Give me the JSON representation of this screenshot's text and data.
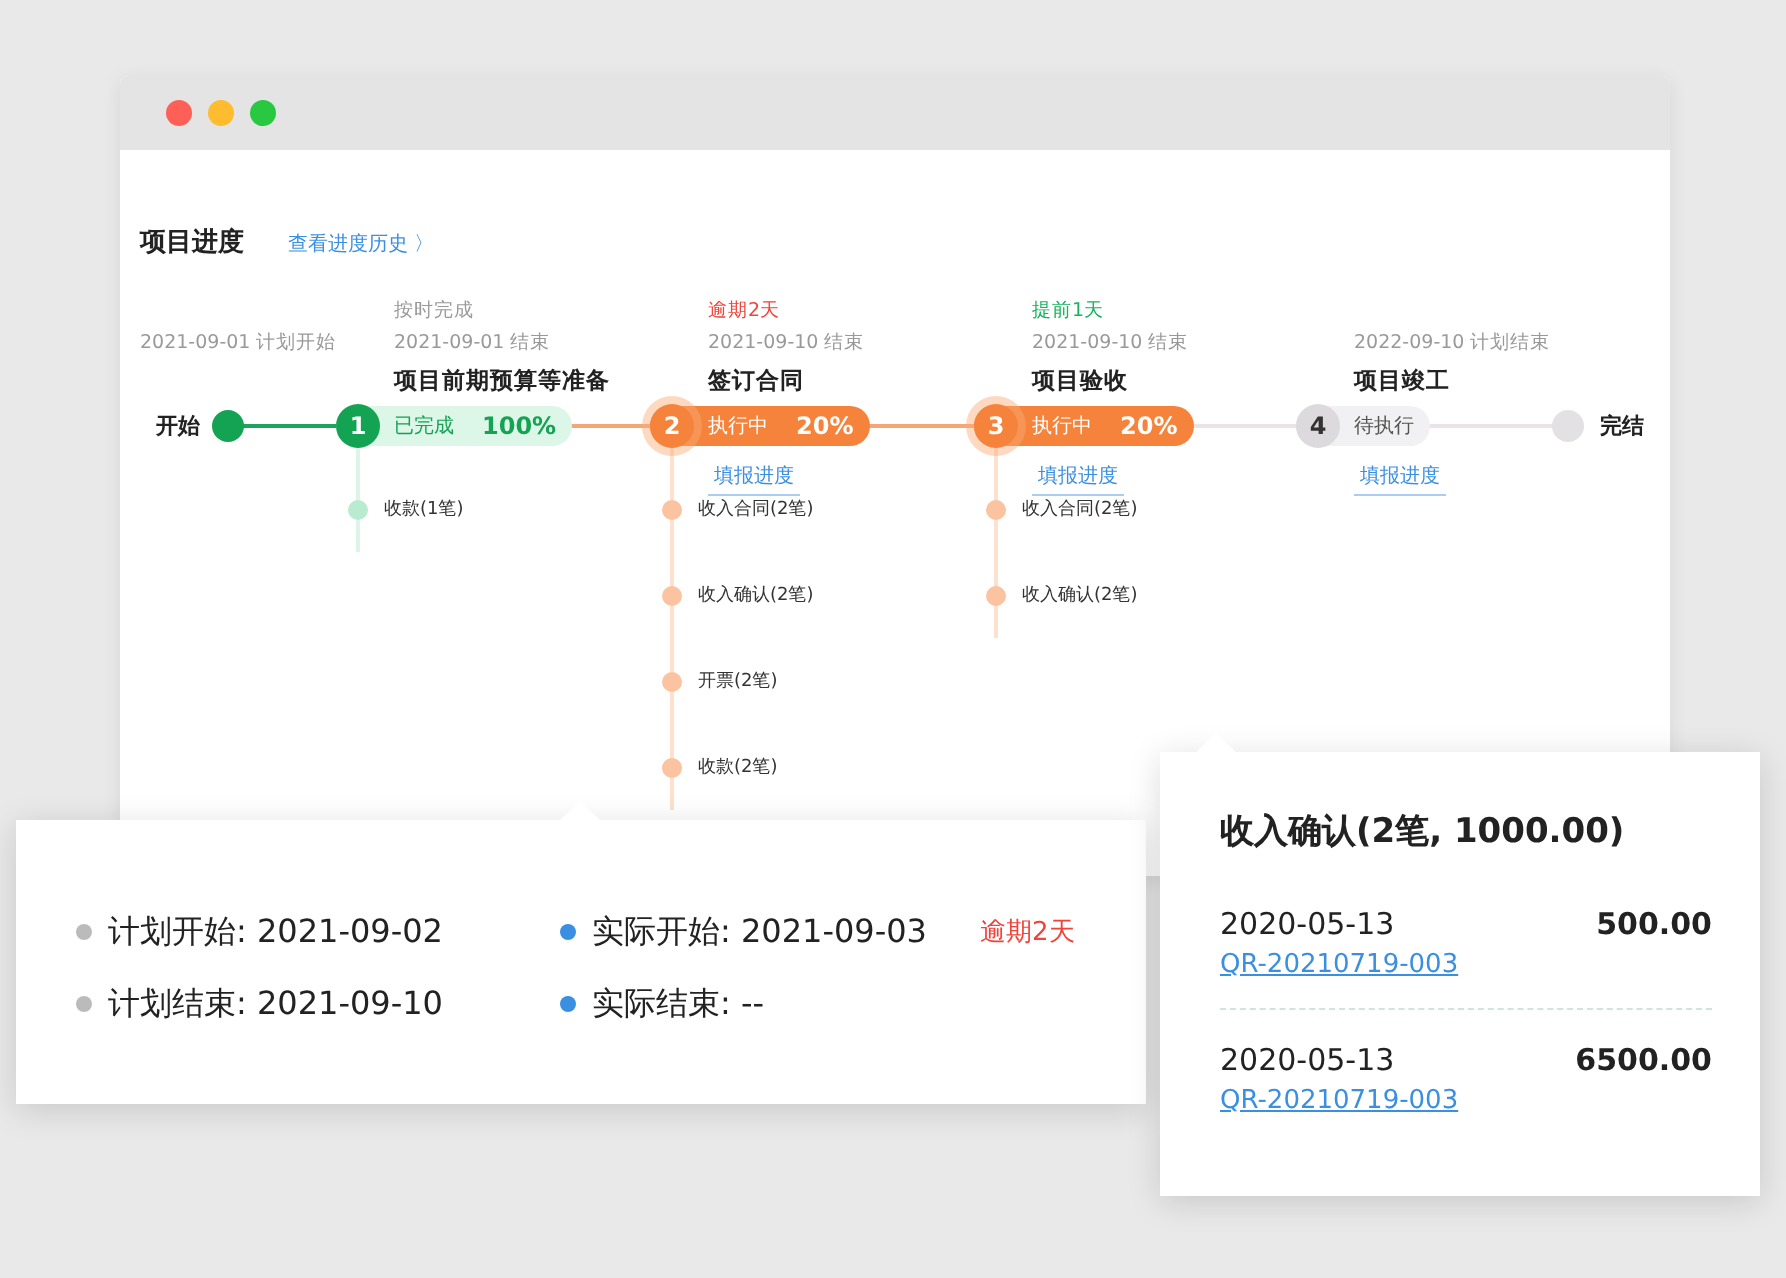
{
  "title": "项目进度",
  "history_link": "查看进度历史 〉",
  "start": {
    "date": "2021-09-01 计划开始",
    "label": "开始"
  },
  "end": {
    "label": "完结"
  },
  "stages": [
    {
      "number": "1",
      "kind": "done",
      "note": {
        "text": "按时完成",
        "color": "#999999"
      },
      "date": "2021-09-01 结束",
      "name": "项目前期预算等准备",
      "status": "已完成",
      "percent": "100%",
      "items": [
        "收款(1笔)"
      ]
    },
    {
      "number": "2",
      "kind": "active",
      "note": {
        "text": "逾期2天",
        "color": "#f0433a"
      },
      "date": "2021-09-10 结束",
      "name": "签订合同",
      "status": "执行中",
      "percent": "20%",
      "report_link": "填报进度",
      "items": [
        "收入合同(2笔)",
        "收入确认(2笔)",
        "开票(2笔)",
        "收款(2笔)"
      ]
    },
    {
      "number": "3",
      "kind": "active",
      "note": {
        "text": "提前1天",
        "color": "#17b25c"
      },
      "date": "2021-09-10 结束",
      "name": "项目验收",
      "status": "执行中",
      "percent": "20%",
      "report_link": "填报进度",
      "items": [
        "收入合同(2笔)",
        "收入确认(2笔)"
      ]
    },
    {
      "number": "4",
      "kind": "pending",
      "date": "2022-09-10 计划结束",
      "name": "项目竣工",
      "status": "待执行",
      "report_link": "填报进度"
    }
  ],
  "date_popup": {
    "rows": [
      {
        "plan_label": "计划开始: 2021-09-02",
        "actual_label": "实际开始: 2021-09-03",
        "flag": "逾期2天"
      },
      {
        "plan_label": "计划结束: 2021-09-10",
        "actual_label": "实际结束: --"
      }
    ]
  },
  "detail_popup": {
    "title": "收入确认(2笔, 1000.00)",
    "entries": [
      {
        "date": "2020-05-13",
        "amount": "500.00",
        "code": "QR-20210719-003"
      },
      {
        "date": "2020-05-13",
        "amount": "6500.00",
        "code": "QR-20210719-003"
      }
    ]
  }
}
